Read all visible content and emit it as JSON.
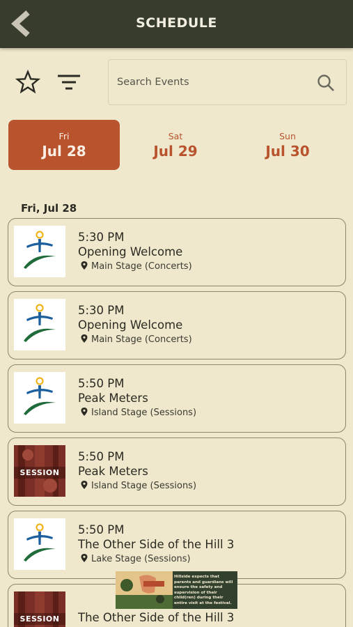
{
  "header": {
    "title": "SCHEDULE",
    "back_icon": "chevron-left-icon"
  },
  "toolbar": {
    "favorites_icon": "star-outline-icon",
    "filter_icon": "filter-icon",
    "search_placeholder": "Search Events",
    "search_icon": "search-icon"
  },
  "date_tabs": [
    {
      "dow": "Fri",
      "date": "Jul 28",
      "active": true
    },
    {
      "dow": "Sat",
      "date": "Jul 29",
      "active": false
    },
    {
      "dow": "Sun",
      "date": "Jul 30",
      "active": false
    }
  ],
  "section": {
    "title": "Fri, Jul 28"
  },
  "events": [
    {
      "time": "5:30 PM",
      "title": "Opening Welcome",
      "location": "Main Stage (Concerts)",
      "thumb": "festival-logo"
    },
    {
      "time": "5:30 PM",
      "title": "Opening Welcome",
      "location": "Main Stage (Concerts)",
      "thumb": "festival-logo"
    },
    {
      "time": "5:50 PM",
      "title": "Peak Meters",
      "location": "Island Stage (Sessions)",
      "thumb": "festival-logo"
    },
    {
      "time": "5:50 PM",
      "title": "Peak Meters",
      "location": "Island Stage (Sessions)",
      "thumb": "session",
      "thumb_label": "SESSION"
    },
    {
      "time": "5:50 PM",
      "title": "The Other Side of the Hill 3",
      "location": "Lake Stage (Sessions)",
      "thumb": "festival-logo"
    },
    {
      "title": "The Other Side of the Hill 3",
      "thumb": "session",
      "thumb_label": "SESSION"
    }
  ],
  "ad": {
    "text": "Hillside expects that parents and guardians will ensure the safety and supervision of their child(ren) during their entire visit at the festival."
  },
  "colors": {
    "header_bg": "#373c2c",
    "page_bg": "#efe8cc",
    "accent": "#b9532e",
    "logo_blue": "#1b5f9e",
    "logo_green": "#1f6b3a",
    "logo_yellow": "#f1b51c"
  }
}
